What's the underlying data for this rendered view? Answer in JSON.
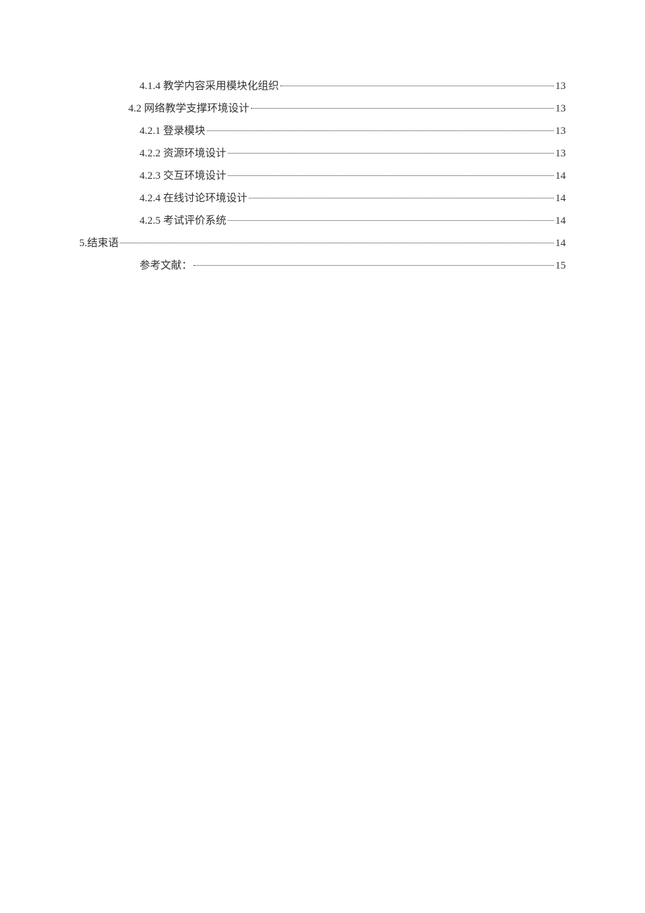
{
  "toc": [
    {
      "label": "4.1.4 教学内容采用模块化组织",
      "page": "13",
      "indent": 2
    },
    {
      "label": "4.2 网络教学支撑环境设计",
      "page": "13",
      "indent": 1
    },
    {
      "label": "4.2.1 登录模块",
      "page": "13",
      "indent": 2
    },
    {
      "label": "4.2.2 资源环境设计",
      "page": "13",
      "indent": 2
    },
    {
      "label": "4.2.3 交互环境设计",
      "page": "14",
      "indent": 2
    },
    {
      "label": "4.2.4 在线讨论环境设计",
      "page": "14",
      "indent": 2
    },
    {
      "label": "4.2.5 考试评价系统",
      "page": "14",
      "indent": 2
    },
    {
      "label": "5.结束语",
      "page": "14",
      "indent": 0
    },
    {
      "label": "参考文献：",
      "page": "15",
      "indent": 2
    }
  ]
}
